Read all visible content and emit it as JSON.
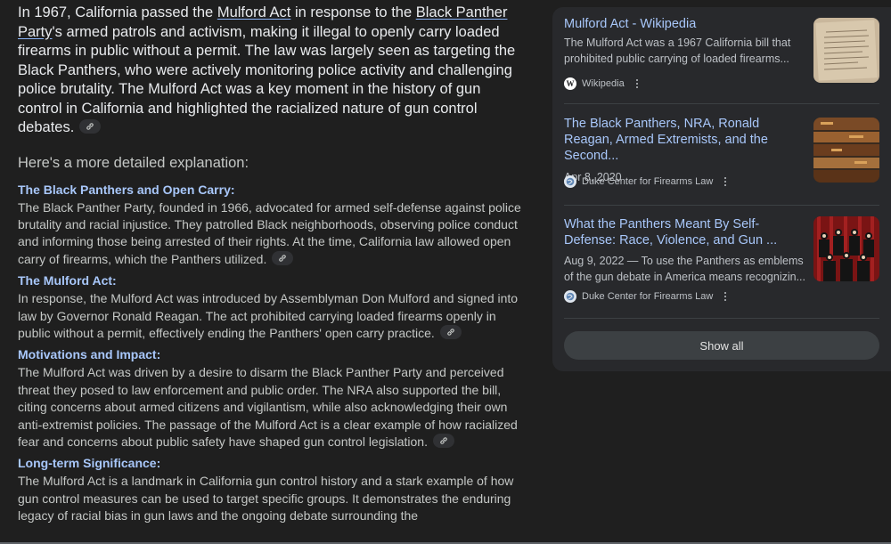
{
  "intro": {
    "t1": "In 1967, California passed the ",
    "link1": "Mulford Act",
    "t2": " in response to the ",
    "link2": "Black Panther Party",
    "t3": "'s armed patrols and activism, making it illegal to openly carry loaded firearms in public without a permit. The law was largely seen as targeting the Black Panthers, who were actively monitoring police activity and challenging police brutality. The Mulford Act was a key moment in the history of gun control in California and highlighted the racialized nature of gun control debates."
  },
  "lead": "Here's a more detailed explanation:",
  "sections": [
    {
      "heading": "The Black Panthers and Open Carry:",
      "body": "The Black Panther Party, founded in 1966, advocated for armed self-defense against police brutality and racial injustice. They patrolled Black neighborhoods, observing police conduct and informing those being arrested of their rights. At the time, California law allowed open carry of firearms, which the Panthers utilized."
    },
    {
      "heading": "The Mulford Act:",
      "body": "In response, the Mulford Act was introduced by Assemblyman Don Mulford and signed into law by Governor Ronald Reagan. The act prohibited carrying loaded firearms openly in public without a permit, effectively ending the Panthers' open carry practice."
    },
    {
      "heading": "Motivations and Impact:",
      "body": "The Mulford Act was driven by a desire to disarm the Black Panther Party and perceived threat they posed to law enforcement and public order. The NRA also supported the bill, citing concerns about armed citizens and vigilantism, while also acknowledging their own anti-extremist policies. The passage of the Mulford Act is a clear example of how racialized fear and concerns about public safety have shaped gun control legislation."
    },
    {
      "heading": "Long-term Significance:",
      "body": "The Mulford Act is a landmark in California gun control history and a stark example of how gun control measures can be used to target specific groups. It demonstrates the enduring legacy of racial bias in gun laws and the ongoing debate surrounding the"
    }
  ],
  "sources": [
    {
      "title": "Mulford Act - Wikipedia",
      "snippet": "The Mulford Act was a 1967 California bill that prohibited public carrying of loaded firearms...",
      "site": "Wikipedia",
      "logo": "wikipedia-icon",
      "logo_text": "W"
    },
    {
      "title": "The Black Panthers, NRA, Ronald Reagan, Armed Extremists, and the Second...",
      "snippet": "Apr 8, 2020",
      "site": "Duke Center for Firearms Law",
      "logo": "duke-icon"
    },
    {
      "title": "What the Panthers Meant By Self-Defense: Race, Violence, and Gun ...",
      "snippet": "Aug 9, 2022 — To use the Panthers as emblems of the gun debate in America means recognizin...",
      "site": "Duke Center for Firearms Law",
      "logo": "duke-icon"
    }
  ],
  "show_all": "Show all",
  "colors": {
    "background": "#1f1f1f",
    "panel": "#28292c",
    "link_blue": "#a8c7fa",
    "text": "#e3e3e3"
  }
}
